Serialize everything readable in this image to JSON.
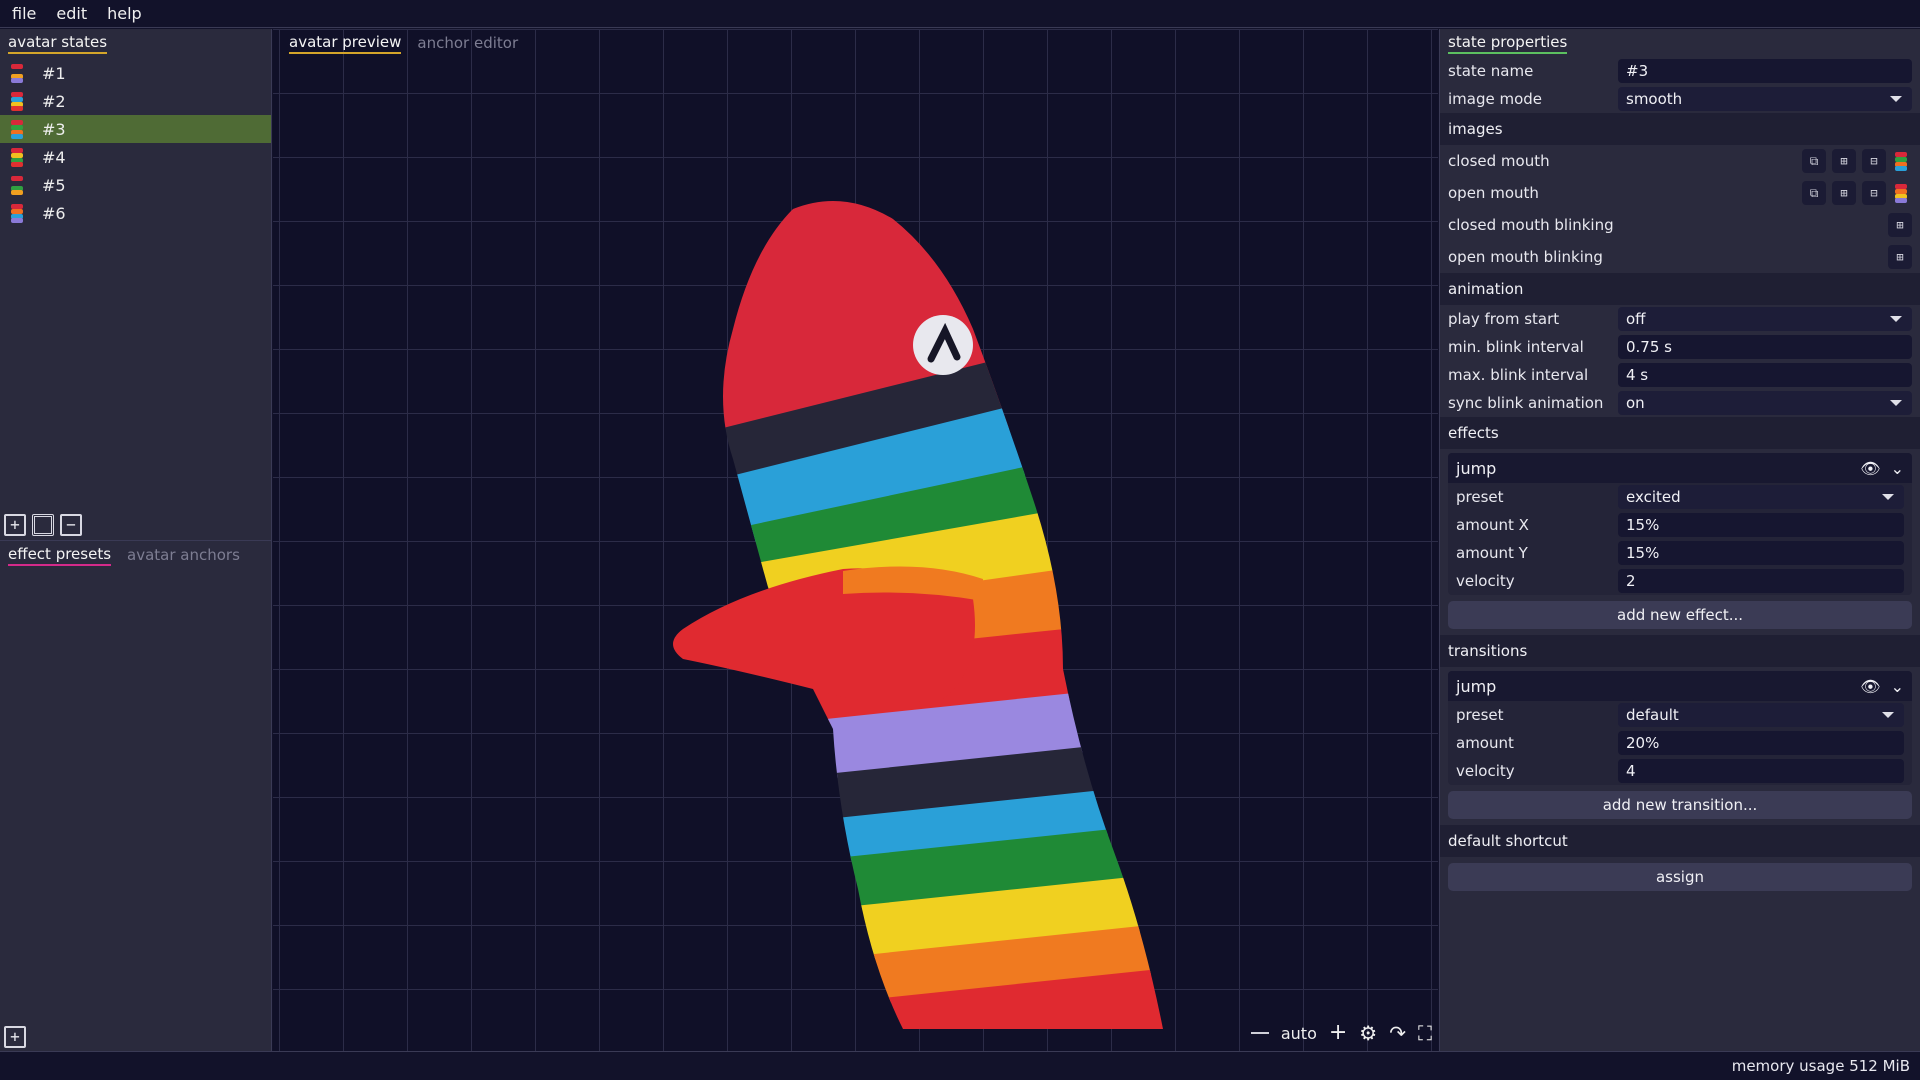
{
  "menu": {
    "file": "file",
    "edit": "edit",
    "help": "help"
  },
  "left": {
    "tabs": {
      "states": "avatar states"
    },
    "states": [
      {
        "label": "#1"
      },
      {
        "label": "#2"
      },
      {
        "label": "#3"
      },
      {
        "label": "#4"
      },
      {
        "label": "#5"
      },
      {
        "label": "#6"
      }
    ],
    "selected_state": "#3",
    "lower_tabs": {
      "active": "effect presets",
      "inactive": "avatar anchors"
    }
  },
  "center": {
    "tabs": {
      "active": "avatar preview",
      "inactive": "anchor editor"
    },
    "zoom_label": "auto"
  },
  "right": {
    "header": "state properties",
    "state_name_label": "state name",
    "state_name_value": "#3",
    "image_mode_label": "image mode",
    "image_mode_value": "smooth",
    "images_head": "images",
    "images": {
      "closed_mouth": "closed mouth",
      "open_mouth": "open mouth",
      "closed_mouth_blinking": "closed mouth blinking",
      "open_mouth_blinking": "open mouth blinking"
    },
    "animation_head": "animation",
    "animation": {
      "play_from_start_label": "play from start",
      "play_from_start_value": "off",
      "min_blink_label": "min. blink interval",
      "min_blink_value": "0.75 s",
      "max_blink_label": "max. blink interval",
      "max_blink_value": "4 s",
      "sync_blink_label": "sync blink animation",
      "sync_blink_value": "on"
    },
    "effects_head": "effects",
    "effect": {
      "name": "jump",
      "preset_label": "preset",
      "preset_value": "excited",
      "amount_x_label": "amount X",
      "amount_x_value": "15%",
      "amount_y_label": "amount Y",
      "amount_y_value": "15%",
      "velocity_label": "velocity",
      "velocity_value": "2"
    },
    "add_effect": "add new effect...",
    "transitions_head": "transitions",
    "transition": {
      "name": "jump",
      "preset_label": "preset",
      "preset_value": "default",
      "amount_label": "amount",
      "amount_value": "20%",
      "velocity_label": "velocity",
      "velocity_value": "4"
    },
    "add_transition": "add new transition...",
    "shortcut_head": "default shortcut",
    "assign": "assign"
  },
  "status": {
    "memory": "memory usage 512 MiB"
  },
  "colors": {
    "accent_underline": "#d4a52a",
    "selected_row": "#4f6b35",
    "panel": "#2a2a3d",
    "canvas": "#101028"
  }
}
